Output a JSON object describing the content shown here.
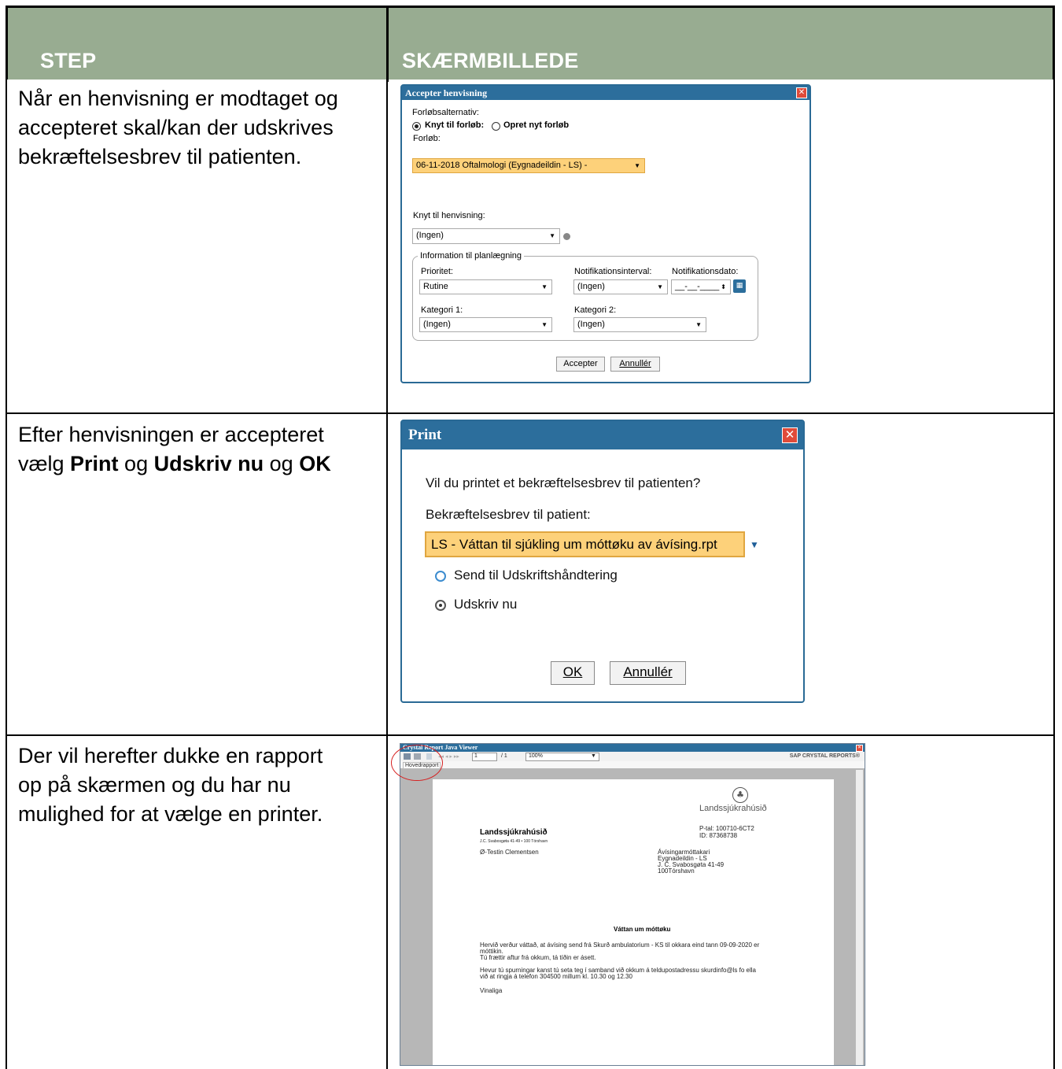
{
  "header": {
    "col1": "STEP",
    "col2": "SKÆRMBILLEDE"
  },
  "steps": {
    "s1": {
      "line1": "Når en henvisning er modtaget og",
      "line2": "accepteret skal/kan der udskrives",
      "line3": "bekræftelsesbrev til patienten."
    },
    "s2": {
      "line1": "Efter henvisningen er accepteret",
      "pre": "vælg ",
      "b1": "Print",
      "mid1": " og ",
      "b2": "Udskriv nu",
      "mid2": " og ",
      "b3": "OK"
    },
    "s3": {
      "line1": "Der vil herefter dukke en rapport",
      "line2": "op på skærmen og du har nu",
      "line3": "mulighed for at vælge en printer."
    }
  },
  "dialog1": {
    "title": "Accepter henvisning",
    "forlob_alt_label": "Forløbsalternativ:",
    "radio1": "Knyt til forløb:",
    "radio2": "Opret nyt forløb",
    "forlob_label": "Forløb:",
    "forlob_value": "06-11-2018 Oftalmologi (Eygnadeildin - LS) -",
    "knyt_label": "Knyt til henvisning:",
    "knyt_value": "(Ingen)",
    "group_title": "Information til planlægning",
    "prioritet_label": "Prioritet:",
    "prioritet_value": "Rutine",
    "notif_int_label": "Notifikationsinterval:",
    "notif_int_value": "(Ingen)",
    "notif_dato_label": "Notifikationsdato:",
    "notif_dato_value": "__-__-____",
    "kat1_label": "Kategori 1:",
    "kat1_value": "(Ingen)",
    "kat2_label": "Kategori 2:",
    "kat2_value": "(Ingen)",
    "accept_btn": "Accepter",
    "cancel_btn": "Annullér"
  },
  "dialog2": {
    "title": "Print",
    "question": "Vil du printet et bekræftelsesbrev til patienten?",
    "select_label": "Bekræftelsesbrev til patient:",
    "select_value": "LS - Váttan til sjúkling um móttøku av ávísing.rpt",
    "radio1": "Send til Udskriftshåndtering",
    "radio2": "Udskriv nu",
    "ok_btn": "OK",
    "cancel_btn": "Annullér"
  },
  "viewer": {
    "title": "Crystal Report Java Viewer",
    "page_input": "1",
    "page_total": "/ 1",
    "zoom": "100%",
    "brand": "SAP CRYSTAL REPORTS®",
    "tab": "Hovedrapport",
    "logo_text": "Landssjúkrahúsið",
    "org_name": "Landssjúkrahúsið",
    "org_addr": "J.C. Svabosgøta 41-49 • 100 Tórshavn",
    "ptal": "P-tal: 100710-6CT2",
    "id": "ID: 87368738",
    "patient": "Ø-Testin Clementsen",
    "recv1": "Ávísingarmóttakari",
    "recv2": "Eygnadeildin - LS",
    "recv3": "J. C. Svabosgøta 41-49",
    "recv4": "100Tórshavn",
    "heading": "Váttan um móttøku",
    "para1a": "Hervið verður váttað, at ávísing send frá Skurð ambulatorium - KS til okkara eind tann 09-09-2020 er",
    "para1b": "móttikin.",
    "para1c": "Tú frættir aftur frá okkum, tá tíðin er ásett.",
    "para2a": "Hevur tú spurningar kanst tú seta teg í samband við okkum á teldupostadressu skurdinfo@ls fo ella",
    "para2b": "við at ringja á telefon 304500 millum kl. 10.30 og 12.30",
    "sign": "Vinaliga"
  }
}
